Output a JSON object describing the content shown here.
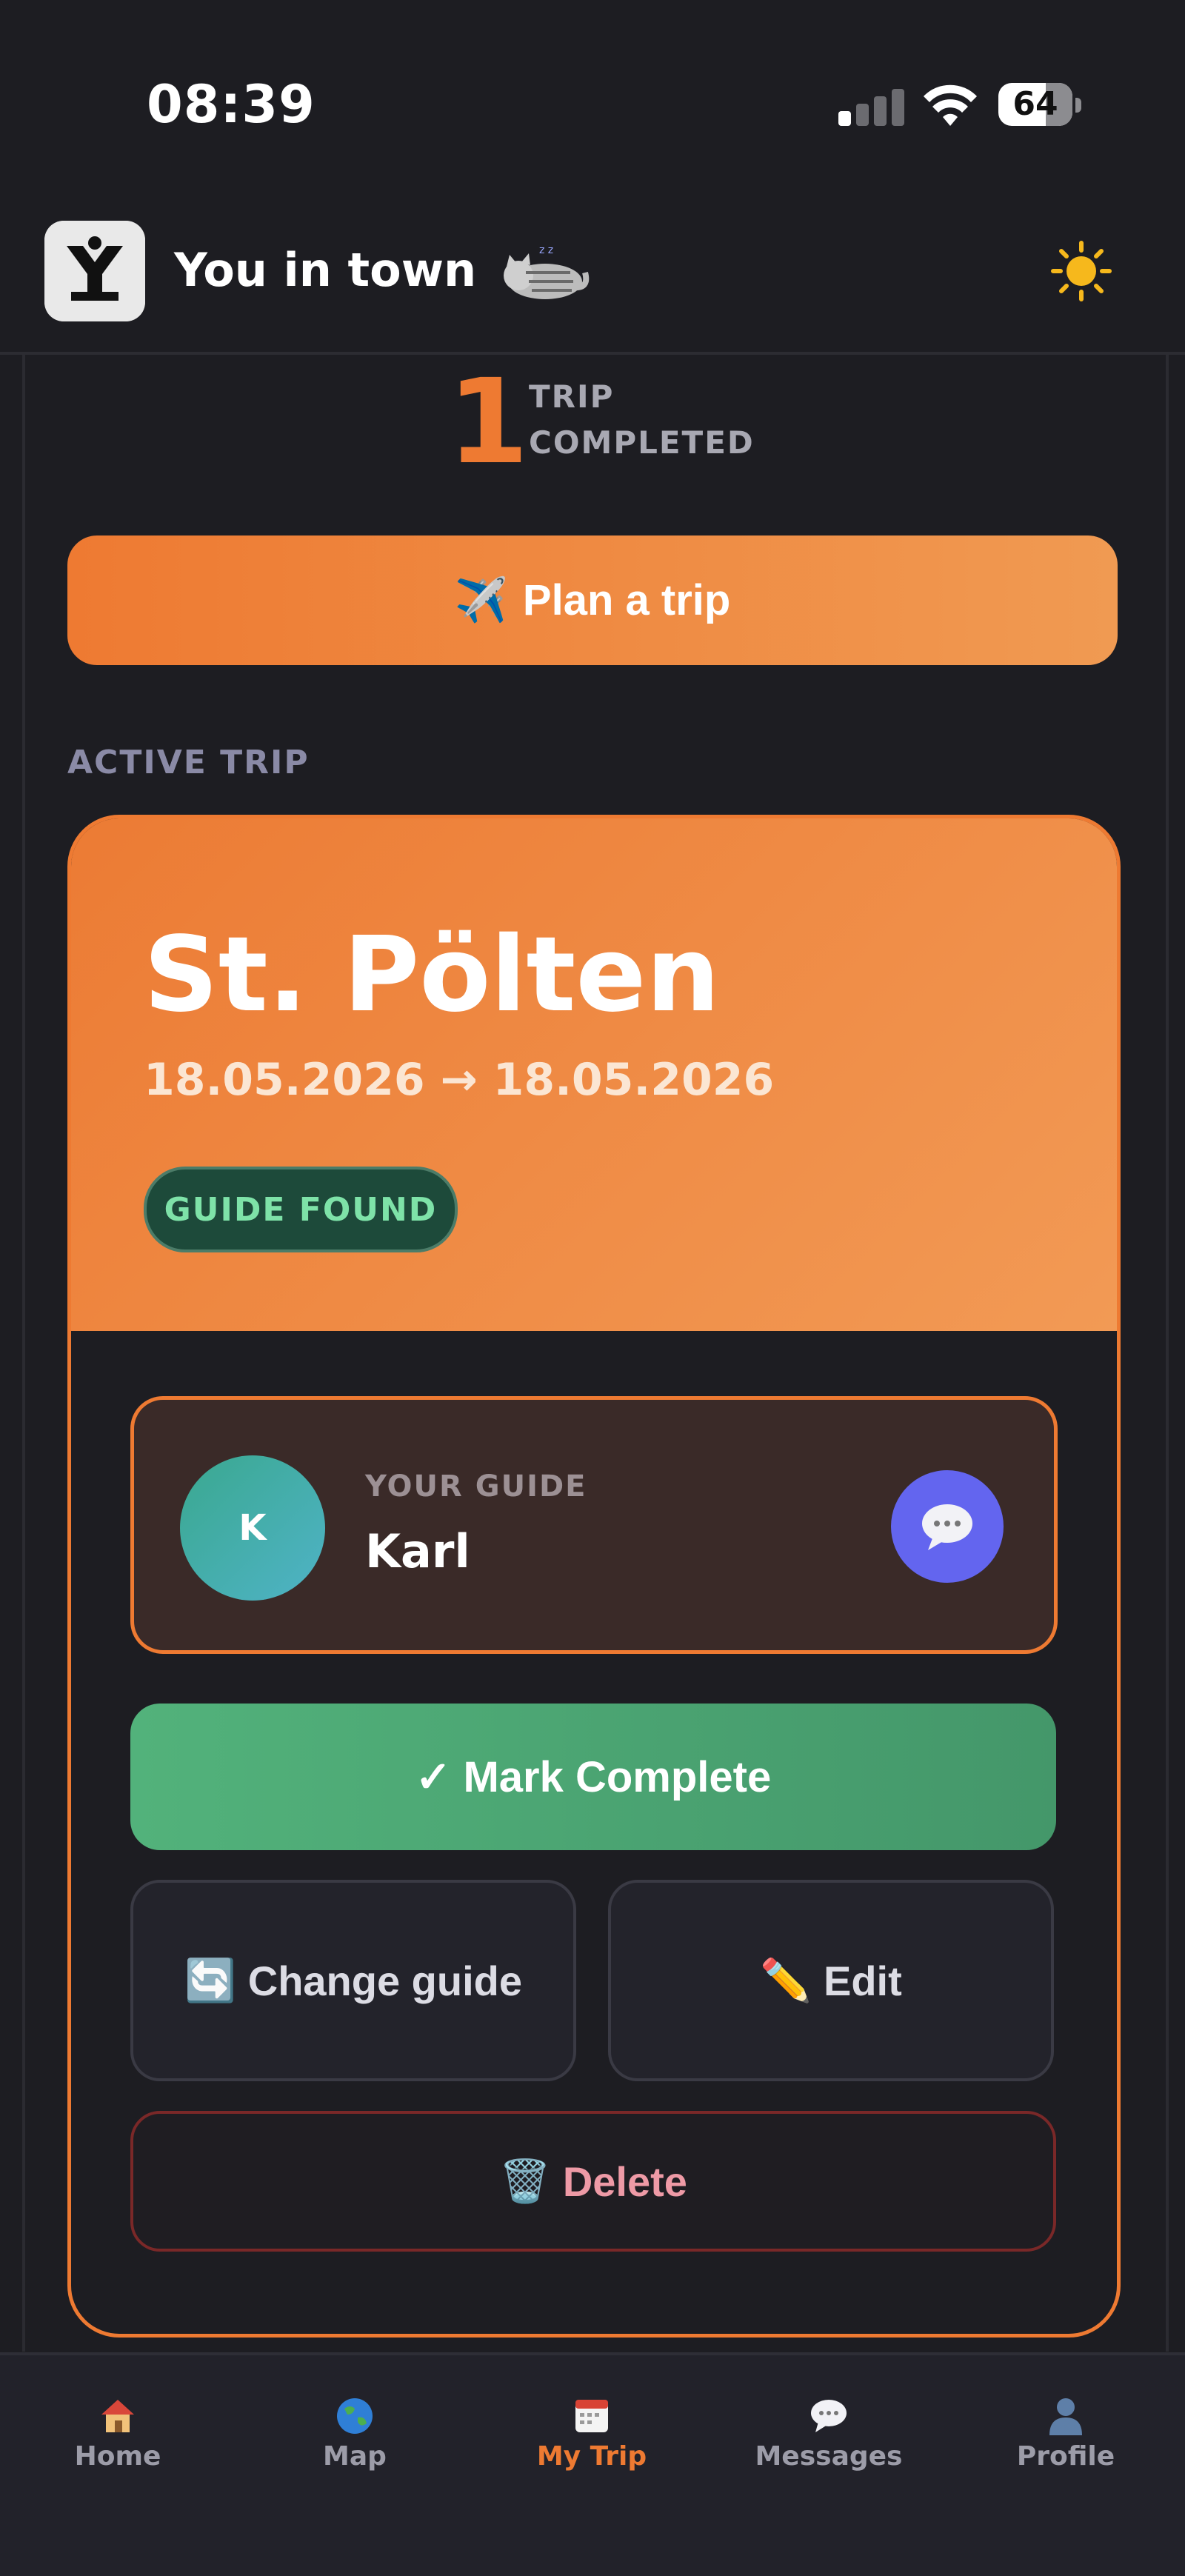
{
  "status_bar": {
    "time": "08:39",
    "battery": "64"
  },
  "header": {
    "app_name": "You in town"
  },
  "stats": {
    "trips_completed_count": "1",
    "trips_completed_line1": "TRIP",
    "trips_completed_line2": "COMPLETED"
  },
  "plan_trip": {
    "label": "Plan a trip"
  },
  "active_trip": {
    "section_label": "ACTIVE TRIP",
    "city": "St. Pölten",
    "dates": "18.05.2026 → 18.05.2026",
    "badge": "GUIDE FOUND",
    "guide": {
      "caption": "YOUR GUIDE",
      "name": "Karl",
      "initial": "K"
    },
    "mark_complete": "✓ Mark Complete",
    "change_guide": "Change guide",
    "edit": "Edit",
    "delete": "Delete"
  },
  "nav": {
    "items": [
      {
        "label": "Home",
        "icon": "house-icon"
      },
      {
        "label": "Map",
        "icon": "globe-icon"
      },
      {
        "label": "My Trip",
        "icon": "calendar-icon"
      },
      {
        "label": "Messages",
        "icon": "speech-bubble-icon"
      },
      {
        "label": "Profile",
        "icon": "person-icon"
      }
    ],
    "active": "My Trip"
  },
  "colors": {
    "accent": "#ee7a32",
    "success": "#4fa873",
    "chat": "#6365ef",
    "danger": "#7a2828"
  }
}
